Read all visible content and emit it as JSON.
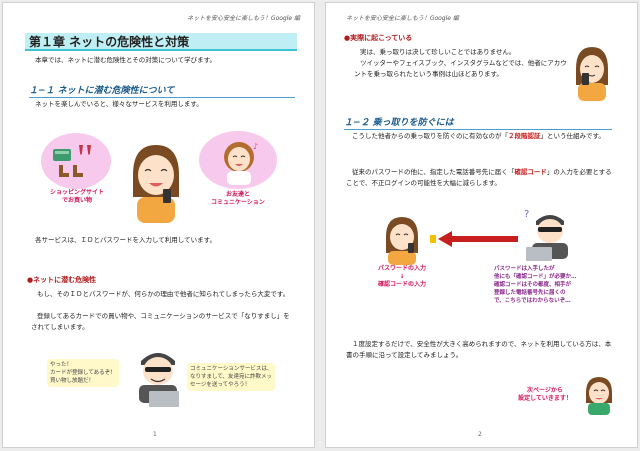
{
  "page1": {
    "header": "ネットを安心安全に楽しもう！Google 編",
    "chapter_title": "第１章 ネットの危険性と対策",
    "intro": "本章では、ネットに潜む危険性とその対策について学びます。",
    "section_title": "１−１ ネットに潜む危険性について",
    "section_text": "ネットを楽しんでいると、様々なサービスを利用します。",
    "shopping_label_1": "ショッピングサイト",
    "shopping_label_2": "でお買い物",
    "communication_label_1": "お友達と",
    "communication_label_2": "コミュニケーション",
    "services_text": "各サービスは、ＩＤとパスワードを入力して利用しています。",
    "danger_heading": "●ネットに潜む危険性",
    "danger_text_1": "もし、そのＩＤとパスワードが、何らかの理由で他者に知られてしまったら大変です。",
    "danger_text_2": "登録してあるカードでの買い物や、コミュニケーションのサービスで「なりすまし」をされてしまいます。",
    "thief_say_1": "やった！",
    "thief_say_2": "カードが登録してあるぞ！",
    "thief_say_3": "買い物し放題だ！",
    "thief_comm_1": "コミュニケーションサービスは、",
    "thief_comm_2": "なりすまして、友達宛に詐欺メッ",
    "thief_comm_3": "セージを送ってやろう！",
    "page_number": "1"
  },
  "page2": {
    "header": "ネットを安心安全に楽しもう！Google 編",
    "actual_heading": "●実際に起こっている",
    "actual_text_1": "実は、乗っ取りは決して珍しいことではありません。",
    "actual_text_2": "ツイッターやフェイスブック、インスタグラムなどでは、他者にアカウントを乗っ取られたという事例は山ほどあります。",
    "section_title": "１−２ 乗っ取りを防ぐには",
    "prevent_text_prefix": "こうした他者からの乗っ取りを防ぐのに有効なのが「",
    "prevent_highlight": "２段階認証",
    "prevent_text_suffix": "」という仕組みです。",
    "code_text_prefix": "従来のパスワードの他に、指定した電話番号先に届く「",
    "code_highlight": "確認コード",
    "code_text_suffix": "」の入力を必要とすることで、不正ログインの可能性を大幅に減らします。",
    "password_label": "パスワードの入力",
    "arrow_down": "↓",
    "code_label": "確認コードの入力",
    "thief_note_1": "パスワードは入手したが",
    "thief_note_2": "他にも「確認コード」が必要か…",
    "thief_note_3": "確認コードはその都度、相手が",
    "thief_note_4": "登録した電話番号先に届くの",
    "thief_note_5": "で、こちらではわからないぞ…",
    "closing_text": "１度設定するだけで、安全性が大きく高められますので、ネットを利用している方は、本書の手順に沿って設定してみましょう。",
    "next_1": "次ページから",
    "next_2": "設定していきます！",
    "page_number": "2"
  },
  "colors": {
    "accent_cyan": "#3cc3d3",
    "section_blue": "#1a5b8c",
    "danger_red": "#c81e1e",
    "pink": "#d4145a"
  }
}
